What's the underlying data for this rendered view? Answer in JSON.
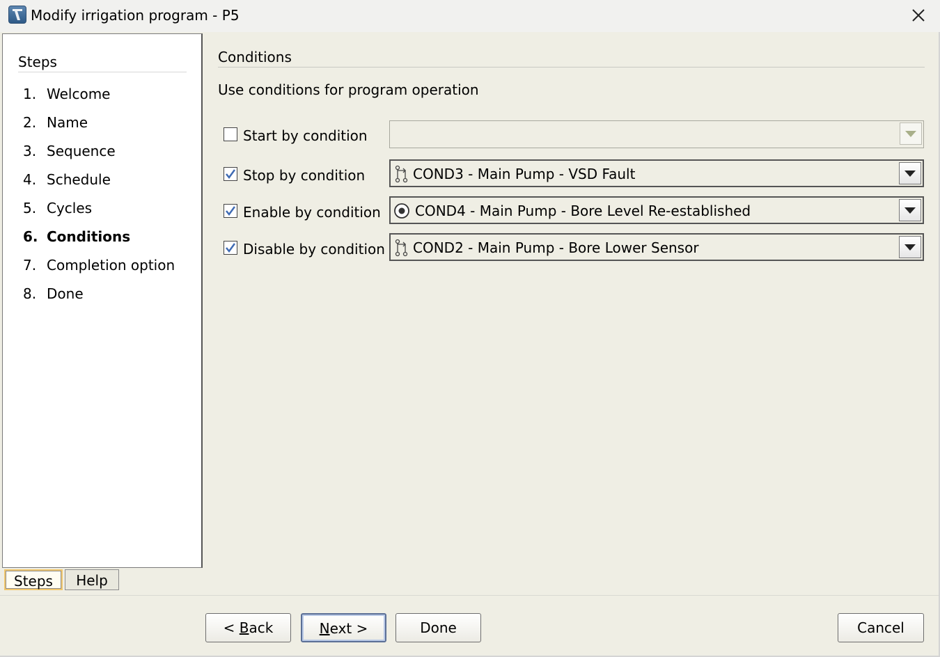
{
  "window": {
    "title": "Modify irrigation program - P5"
  },
  "sidebar": {
    "header": "Steps",
    "items": [
      {
        "num": "1.",
        "label": "Welcome"
      },
      {
        "num": "2.",
        "label": "Name"
      },
      {
        "num": "3.",
        "label": "Sequence"
      },
      {
        "num": "4.",
        "label": "Schedule"
      },
      {
        "num": "5.",
        "label": "Cycles"
      },
      {
        "num": "6.",
        "label": "Conditions",
        "active": true
      },
      {
        "num": "7.",
        "label": "Completion option"
      },
      {
        "num": "8.",
        "label": "Done"
      }
    ],
    "tabs": {
      "steps": "Steps",
      "help": "Help"
    }
  },
  "main": {
    "title": "Conditions",
    "description": "Use conditions for program operation",
    "conditions": [
      {
        "label": "Start by condition",
        "checked": false,
        "value": "",
        "icon": "none"
      },
      {
        "label": "Stop by condition",
        "checked": true,
        "value": "COND3 - Main Pump - VSD Fault",
        "icon": "branch-icon"
      },
      {
        "label": "Enable by condition",
        "checked": true,
        "value": "COND4 - Main Pump - Bore Level Re-established",
        "icon": "radio-target-icon"
      },
      {
        "label": "Disable by condition",
        "checked": true,
        "value": "COND2 - Main Pump - Bore Lower Sensor",
        "icon": "branch-icon"
      }
    ]
  },
  "footer": {
    "back": {
      "pre": "< ",
      "mnemonic": "B",
      "rest": "ack"
    },
    "next": {
      "mnemonic": "N",
      "rest": "ext >"
    },
    "done": "Done",
    "cancel": "Cancel"
  },
  "colors": {
    "dialog_bg": "#efeee4",
    "check_accent": "#3f6bb3",
    "tab_highlight": "#f2c76b"
  }
}
